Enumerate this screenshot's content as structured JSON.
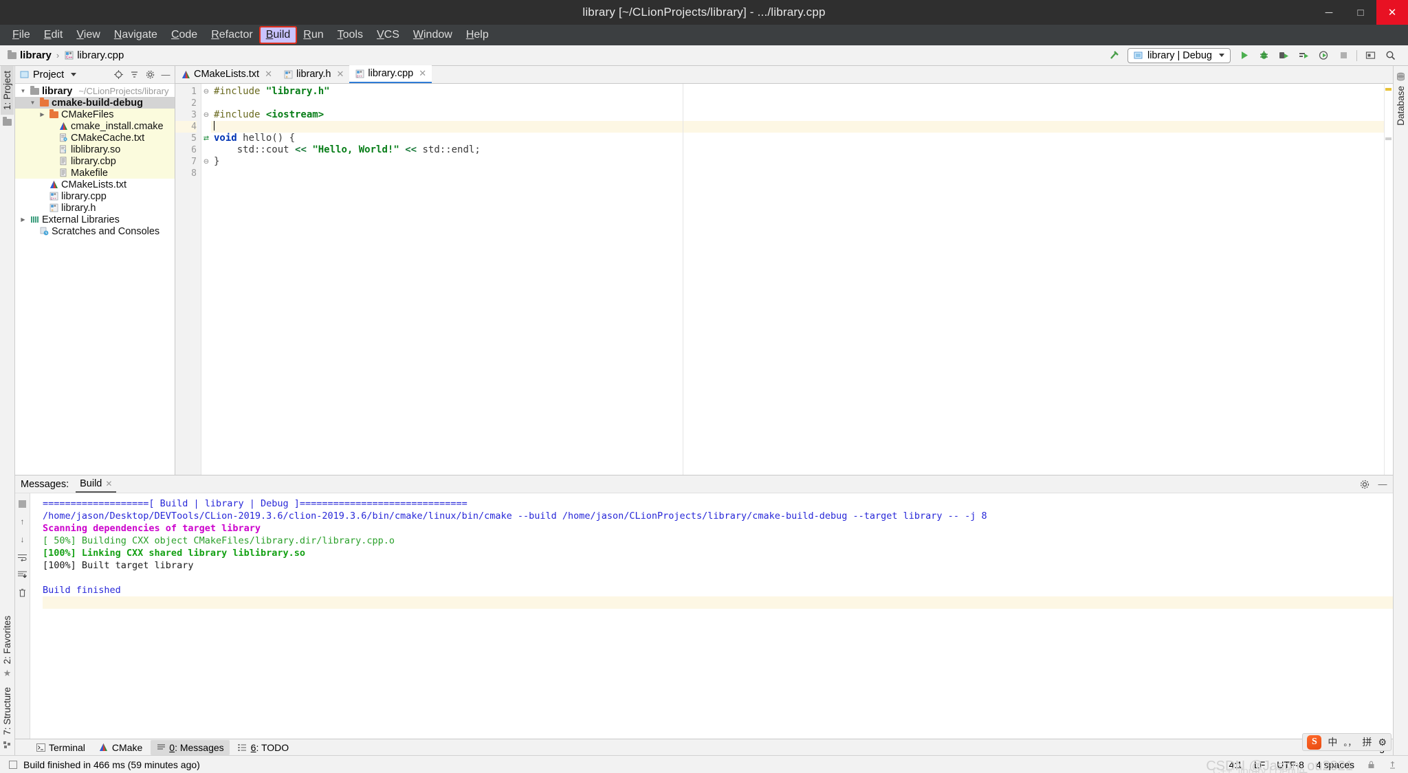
{
  "window": {
    "title": "library [~/CLionProjects/library] - .../library.cpp",
    "minimize": "─",
    "maximize": "□",
    "close": "✕"
  },
  "menubar": {
    "items": [
      {
        "label": "File"
      },
      {
        "label": "Edit"
      },
      {
        "label": "View"
      },
      {
        "label": "Navigate"
      },
      {
        "label": "Code"
      },
      {
        "label": "Refactor"
      },
      {
        "label": "Build",
        "active": true
      },
      {
        "label": "Run"
      },
      {
        "label": "Tools"
      },
      {
        "label": "VCS"
      },
      {
        "label": "Window"
      },
      {
        "label": "Help"
      }
    ]
  },
  "navbar": {
    "breadcrumb": [
      {
        "label": "library",
        "icon": "folder-icon"
      },
      {
        "label": "library.cpp",
        "icon": "cpp-file-icon"
      }
    ],
    "separator": "›",
    "run_config": "library | Debug",
    "icons": [
      "hammer-icon",
      "run-icon",
      "debug-icon",
      "run-with-coverage-icon",
      "profile-icon",
      "attach-icon",
      "stop-icon",
      "console-icon",
      "search-icon"
    ]
  },
  "left_rail": {
    "project_tab": "1: Project",
    "favorites_tab": "2: Favorites",
    "structure_tab": "7: Structure"
  },
  "right_rail": {
    "database_tab": "Database"
  },
  "project_panel": {
    "header": "Project",
    "tree": [
      {
        "label": "library",
        "path": "~/CLionProjects/library",
        "indent": 0,
        "arrow": "▼",
        "icon": "folder-gray",
        "bold": true,
        "hl": false
      },
      {
        "label": "cmake-build-debug",
        "path": "",
        "indent": 1,
        "arrow": "▼",
        "icon": "folder-orange",
        "bold": true,
        "hl": true,
        "sel": true
      },
      {
        "label": "CMakeFiles",
        "path": "",
        "indent": 2,
        "arrow": "▶",
        "icon": "folder-orange",
        "bold": false,
        "hl": true
      },
      {
        "label": "cmake_install.cmake",
        "path": "",
        "indent": 3,
        "arrow": "",
        "icon": "cmake-icon",
        "bold": false,
        "hl": true
      },
      {
        "label": "CMakeCache.txt",
        "path": "",
        "indent": 3,
        "arrow": "",
        "icon": "config-file-icon",
        "bold": false,
        "hl": true
      },
      {
        "label": "liblibrary.so",
        "path": "",
        "indent": 3,
        "arrow": "",
        "icon": "unknown-file-icon",
        "bold": false,
        "hl": true
      },
      {
        "label": "library.cbp",
        "path": "",
        "indent": 3,
        "arrow": "",
        "icon": "text-file-icon",
        "bold": false,
        "hl": true
      },
      {
        "label": "Makefile",
        "path": "",
        "indent": 3,
        "arrow": "",
        "icon": "text-file-icon",
        "bold": false,
        "hl": true
      },
      {
        "label": "CMakeLists.txt",
        "path": "",
        "indent": 2,
        "arrow": "",
        "icon": "cmake-icon",
        "bold": false,
        "hl": false
      },
      {
        "label": "library.cpp",
        "path": "",
        "indent": 2,
        "arrow": "",
        "icon": "cpp-file-icon",
        "bold": false,
        "hl": false
      },
      {
        "label": "library.h",
        "path": "",
        "indent": 2,
        "arrow": "",
        "icon": "h-file-icon",
        "bold": false,
        "hl": false
      },
      {
        "label": "External Libraries",
        "path": "",
        "indent": 0,
        "arrow": "▶",
        "icon": "libraries-icon",
        "bold": false,
        "hl": false
      },
      {
        "label": "Scratches and Consoles",
        "path": "",
        "indent": 1,
        "arrow": "",
        "icon": "scratches-icon",
        "bold": false,
        "hl": false
      }
    ]
  },
  "editor": {
    "tabs": [
      {
        "label": "CMakeLists.txt",
        "icon": "cmake-icon",
        "selected": false
      },
      {
        "label": "library.h",
        "icon": "h-file-icon",
        "selected": false
      },
      {
        "label": "library.cpp",
        "icon": "cpp-file-icon",
        "selected": true
      }
    ],
    "close_glyph": "✕",
    "lines": [
      {
        "n": "1",
        "current": false,
        "fold": "⊖",
        "tokens": [
          {
            "t": "#include ",
            "c": "pp"
          },
          {
            "t": "\"library.h\"",
            "c": "s"
          }
        ]
      },
      {
        "n": "2",
        "current": false,
        "fold": "",
        "tokens": []
      },
      {
        "n": "3",
        "current": false,
        "fold": "⊖",
        "tokens": [
          {
            "t": "#include ",
            "c": "pp"
          },
          {
            "t": "<iostream>",
            "c": "s"
          }
        ]
      },
      {
        "n": "4",
        "current": true,
        "fold": "",
        "tokens": [
          {
            "t": "",
            "c": "caret"
          }
        ]
      },
      {
        "n": "5",
        "current": false,
        "fold": "⊖",
        "tokens": [
          {
            "t": "void",
            "c": "k"
          },
          {
            "t": " hello() {",
            "c": "id"
          }
        ]
      },
      {
        "n": "6",
        "current": false,
        "fold": "",
        "tokens": [
          {
            "t": "    std::cout ",
            "c": "id"
          },
          {
            "t": "<<",
            "c": "op"
          },
          {
            "t": " ",
            "c": "id"
          },
          {
            "t": "\"Hello, World!\"",
            "c": "s"
          },
          {
            "t": " ",
            "c": "id"
          },
          {
            "t": "<<",
            "c": "op"
          },
          {
            "t": " std::endl;",
            "c": "id"
          }
        ]
      },
      {
        "n": "7",
        "current": false,
        "fold": "⊖",
        "tokens": [
          {
            "t": "}",
            "c": "id"
          }
        ]
      },
      {
        "n": "8",
        "current": false,
        "fold": "",
        "tokens": []
      }
    ],
    "gutter_mark_line5": "⇄"
  },
  "build_panel": {
    "label": "Messages:",
    "tab": "Build",
    "close_glyph": "✕",
    "settings_icon": "gear-icon",
    "hide_icon": "minimize-icon",
    "rail_icons": [
      "stop-icon",
      "up-arrow-icon",
      "down-arrow-icon",
      "soft-wrap-icon",
      "scroll-to-end-icon",
      "trash-icon"
    ],
    "output": [
      {
        "text": "===================[ Build | library | Debug ]==============================",
        "color": "c-blue"
      },
      {
        "text": "/home/jason/Desktop/DEVTools/CLion-2019.3.6/clion-2019.3.6/bin/cmake/linux/bin/cmake --build /home/jason/CLionProjects/library/cmake-build-debug --target library -- -j 8",
        "color": "c-blue"
      },
      {
        "text": "Scanning dependencies of target library",
        "color": "c-mag"
      },
      {
        "text": "[ 50%] Building CXX object CMakeFiles/library.dir/library.cpp.o",
        "color": "c-grn"
      },
      {
        "text": "[100%] Linking CXX shared library liblibrary.so",
        "color": "c-grnb"
      },
      {
        "text": "[100%] Built target library",
        "color": "c-blk"
      },
      {
        "text": "",
        "color": "c-blk"
      },
      {
        "text": "Build finished",
        "color": "c-blue"
      },
      {
        "text": "",
        "color": "c-blk",
        "hl": true
      }
    ]
  },
  "ime": {
    "logo": "S",
    "mode": "中",
    "punct": "。，",
    "pinyin": "拼",
    "settings": "⚙"
  },
  "toolwindow_bar": {
    "tabs": [
      {
        "label": "Terminal",
        "icon": "terminal-icon",
        "selected": false
      },
      {
        "label": "CMake",
        "icon": "cmake-icon",
        "selected": false
      },
      {
        "label": "0: Messages",
        "icon": "messages-icon",
        "selected": true
      },
      {
        "label": "6: TODO",
        "icon": "todo-icon",
        "selected": false
      }
    ],
    "event_log": "Event Log"
  },
  "statusbar": {
    "message": "Build finished in 466 ms (59 minutes ago)",
    "caret_position": "4:1",
    "line_separator": "LF",
    "encoding": "UTF-8",
    "indent": "4 spaces",
    "watermark": "CSDN @Jason_ou2021",
    "watermark2": "C++: library | Debug"
  }
}
